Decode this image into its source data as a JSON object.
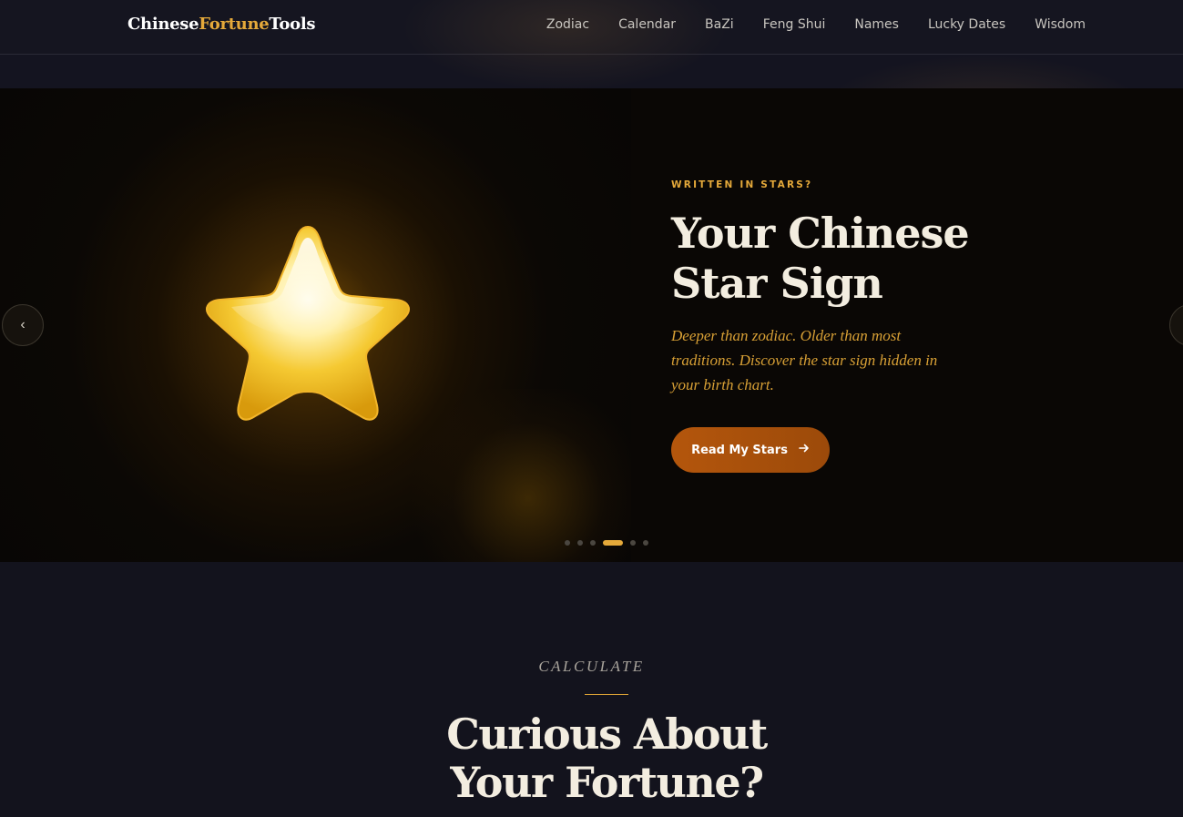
{
  "brand": {
    "logo_part1": "Chinese",
    "logo_part2": "Fortune",
    "logo_part3": "Tools",
    "accent_color": "#e5a93a"
  },
  "nav": {
    "items": [
      "Zodiac",
      "Calendar",
      "BaZi",
      "Feng Shui",
      "Names",
      "Lucky Dates",
      "Wisdom"
    ]
  },
  "hero": {
    "eyebrow": "WRITTEN IN STARS?",
    "title": "Your Chinese Star Sign",
    "description": "Deeper than zodiac. Older than most traditions. Discover the star sign hidden in your birth chart.",
    "cta_label": "Read My Stars",
    "cta_icon": "arrow-right-icon",
    "prev_icon": "chevron-left-icon",
    "next_icon": "chevron-right-icon",
    "prev_glyph": "‹",
    "next_glyph": "›",
    "image_icon": "glowing-star",
    "slides_total": 6,
    "active_slide": 4
  },
  "calculate": {
    "kicker": "CALCULATE",
    "title": "Curious About Your Fortune?"
  }
}
